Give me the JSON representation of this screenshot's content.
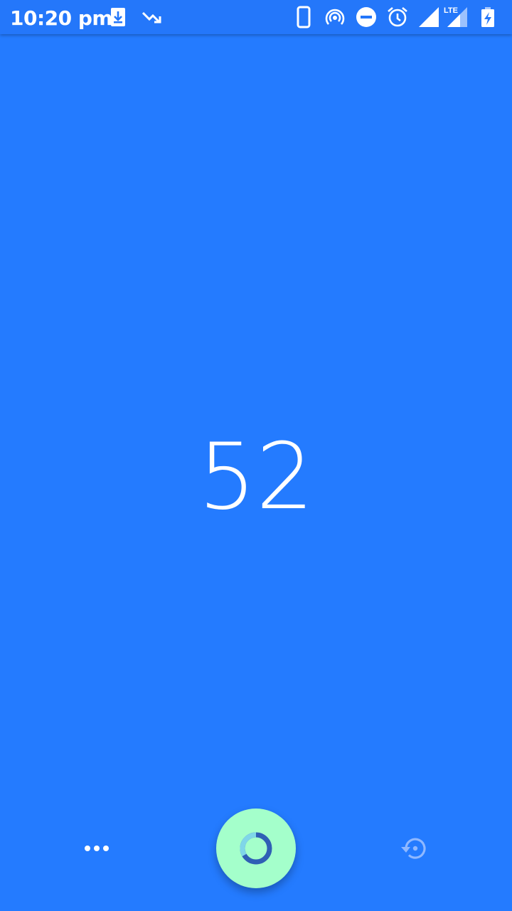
{
  "status_bar": {
    "time": "10:20 pm",
    "icons": [
      "download-icon",
      "trending-down-icon",
      "phone-icon",
      "hotspot-icon",
      "do-not-disturb-icon",
      "alarm-icon",
      "signal-icon",
      "lte-signal-icon",
      "battery-charging-icon"
    ],
    "lte_label": "LTE"
  },
  "main": {
    "count": "52"
  },
  "controls": {
    "more_icon": "more-horizontal-icon",
    "fab_icon": "counter-ring-icon",
    "reset_icon": "reset-history-icon"
  },
  "colors": {
    "background": "#247BFF",
    "status_bar": "#2477FA",
    "fab": "#A4FFCB",
    "ring_dark": "#2F5FB5",
    "ring_light": "#7FD6E8"
  }
}
